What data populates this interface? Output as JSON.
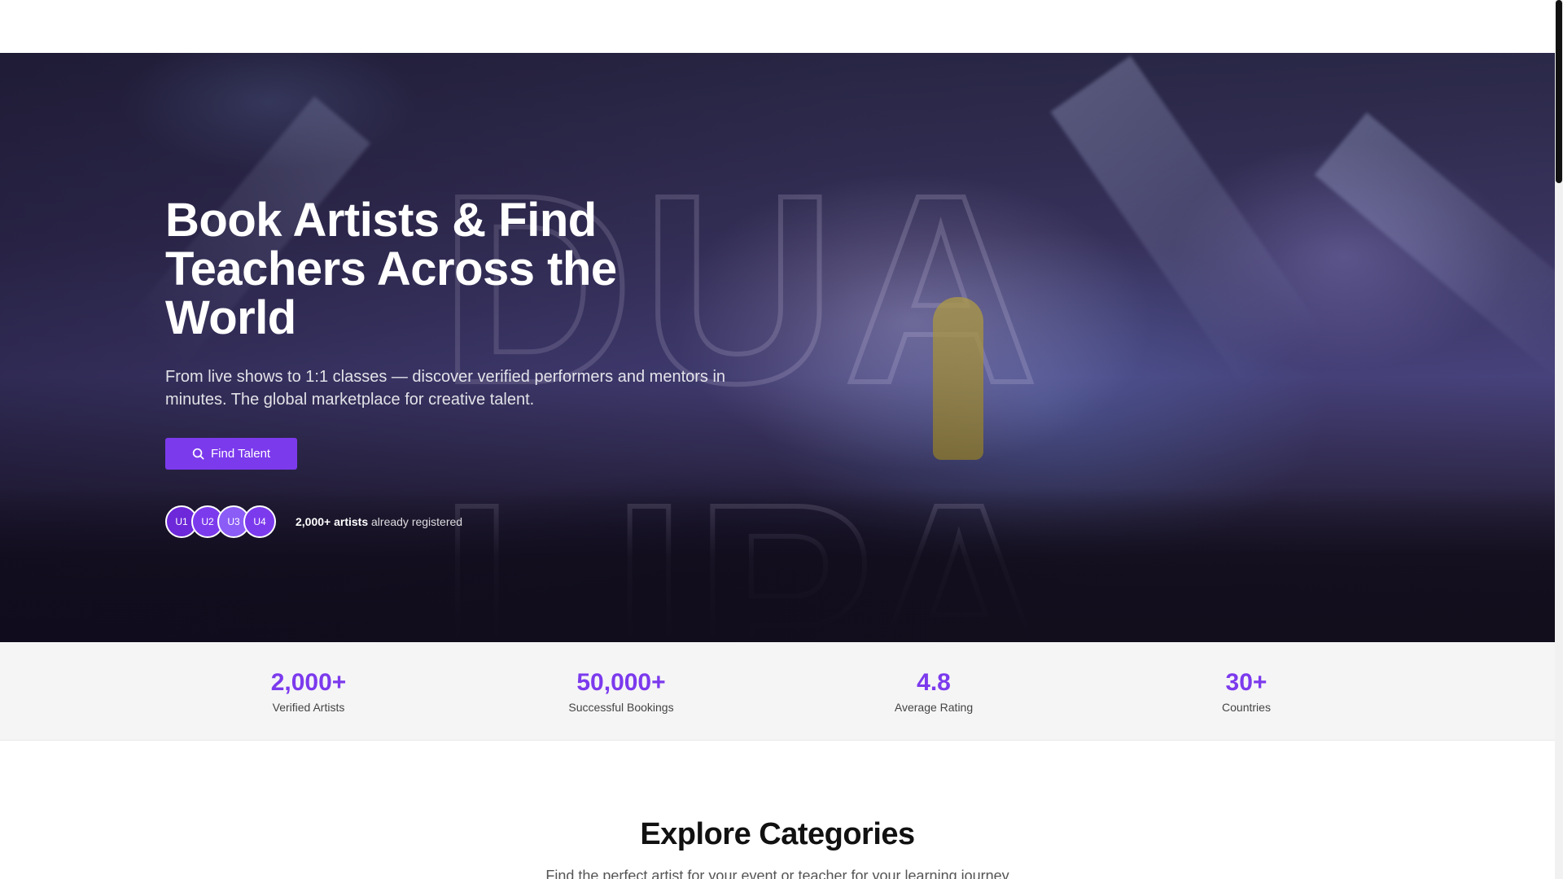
{
  "hero": {
    "title": "Book Artists & Find Teachers Across the World",
    "subtitle": "From live shows to 1:1 classes — discover verified performers and mentors in minutes. The global marketplace for creative talent.",
    "cta_label": "Find Talent",
    "cta_icon": "search-icon",
    "avatars": [
      {
        "label": "U1",
        "color": "#6d28d9"
      },
      {
        "label": "U2",
        "color": "#7c3aed"
      },
      {
        "label": "U3",
        "color": "#8b5cf6"
      },
      {
        "label": "U4",
        "color": "#7c3aed"
      }
    ],
    "social_count": "2,000+ artists",
    "social_text": " already registered"
  },
  "stats": [
    {
      "value": "2,000+",
      "label": "Verified Artists"
    },
    {
      "value": "50,000+",
      "label": "Successful Bookings"
    },
    {
      "value": "4.8",
      "label": "Average Rating"
    },
    {
      "value": "30+",
      "label": "Countries"
    }
  ],
  "categories": {
    "title": "Explore Categories",
    "subtitle": "Find the perfect artist for your event or teacher for your learning journey"
  },
  "colors": {
    "accent": "#7c3aed",
    "stats_bg": "#f5f5f6"
  }
}
